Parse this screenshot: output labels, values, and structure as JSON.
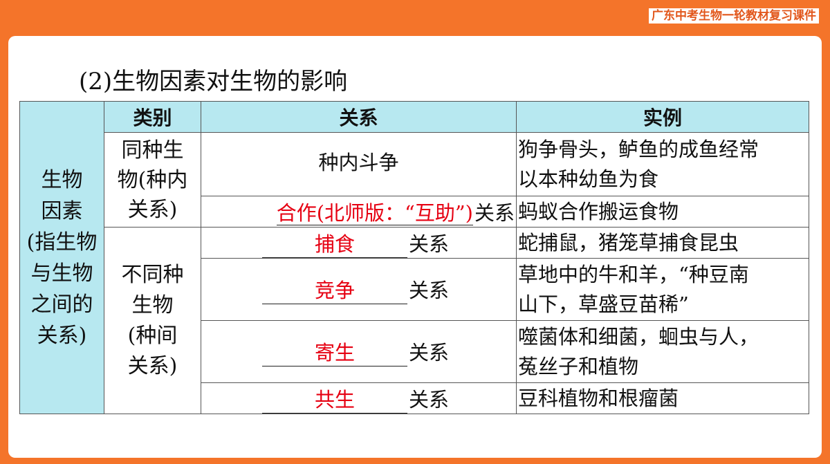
{
  "header": {
    "course_title": "广东中考生物一轮教材复习课件"
  },
  "section_heading": "(2)生物因素对生物的影响",
  "table": {
    "columns": [
      "类别",
      "关系",
      "实例"
    ],
    "category_lines": [
      "生物",
      "因素",
      "(指生物",
      "与生物",
      "之间的",
      "关系)"
    ],
    "same_species_lines": [
      "同种生",
      "物(种内",
      "关系)"
    ],
    "diff_species_lines": [
      "不同种",
      "生物",
      "(种间",
      "关系)"
    ],
    "rows": [
      {
        "relation": "种内斗争",
        "example_lines": [
          "狗争骨头，鲈鱼的成鱼经常",
          "以本种幼鱼为食"
        ]
      },
      {
        "answer": "合作(北师版：“互助”)",
        "suffix": "关系",
        "example_lines": [
          "蚂蚁合作搬运食物"
        ]
      },
      {
        "answer": "捕食",
        "suffix": "关系",
        "example_lines": [
          "蛇捕鼠，猪笼草捕食昆虫"
        ]
      },
      {
        "answer": "竞争",
        "suffix": "关系",
        "example_lines": [
          "草地中的牛和羊，“种豆南",
          "山下，草盛豆苗稀”"
        ]
      },
      {
        "answer": "寄生",
        "suffix": "关系",
        "example_lines": [
          "噬菌体和细菌，蛔虫与人，",
          "菟丝子和植物"
        ]
      },
      {
        "answer": "共生",
        "suffix": "关系",
        "example_lines": [
          "豆科植物和根瘤菌"
        ]
      }
    ]
  },
  "colors": {
    "orange": "#f4742a",
    "header_fill": "#b7e8f0",
    "answer_red": "#e60012"
  }
}
